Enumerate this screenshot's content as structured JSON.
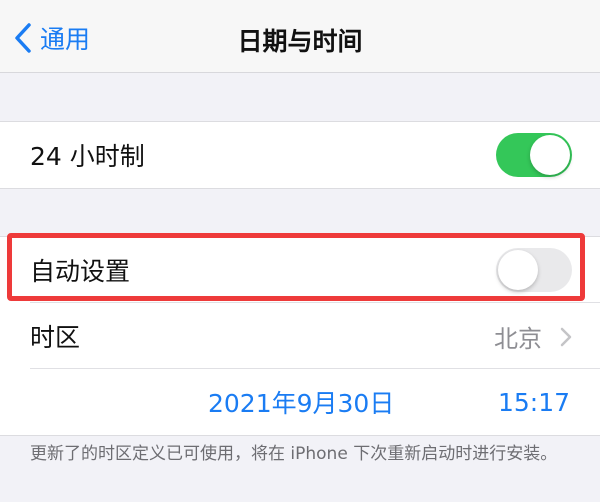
{
  "navbar": {
    "back_label": "通用",
    "title": "日期与时间"
  },
  "settings": {
    "hour24": {
      "label": "24 小时制",
      "enabled": true
    },
    "auto_set": {
      "label": "自动设置",
      "enabled": false
    },
    "timezone": {
      "label": "时区",
      "value": "北京"
    },
    "date": "2021年9月30日",
    "time": "15:17"
  },
  "footnote": "更新了的时区定义已可使用，将在 iPhone 下次重新启动时进行安装。",
  "colors": {
    "accent": "#1a7cf3",
    "toggle_on": "#34c759",
    "toggle_off": "#e9e9eb",
    "highlight": "#ee3a3a"
  },
  "icons": {
    "back": "chevron-left-icon",
    "disclosure": "chevron-right-icon"
  }
}
